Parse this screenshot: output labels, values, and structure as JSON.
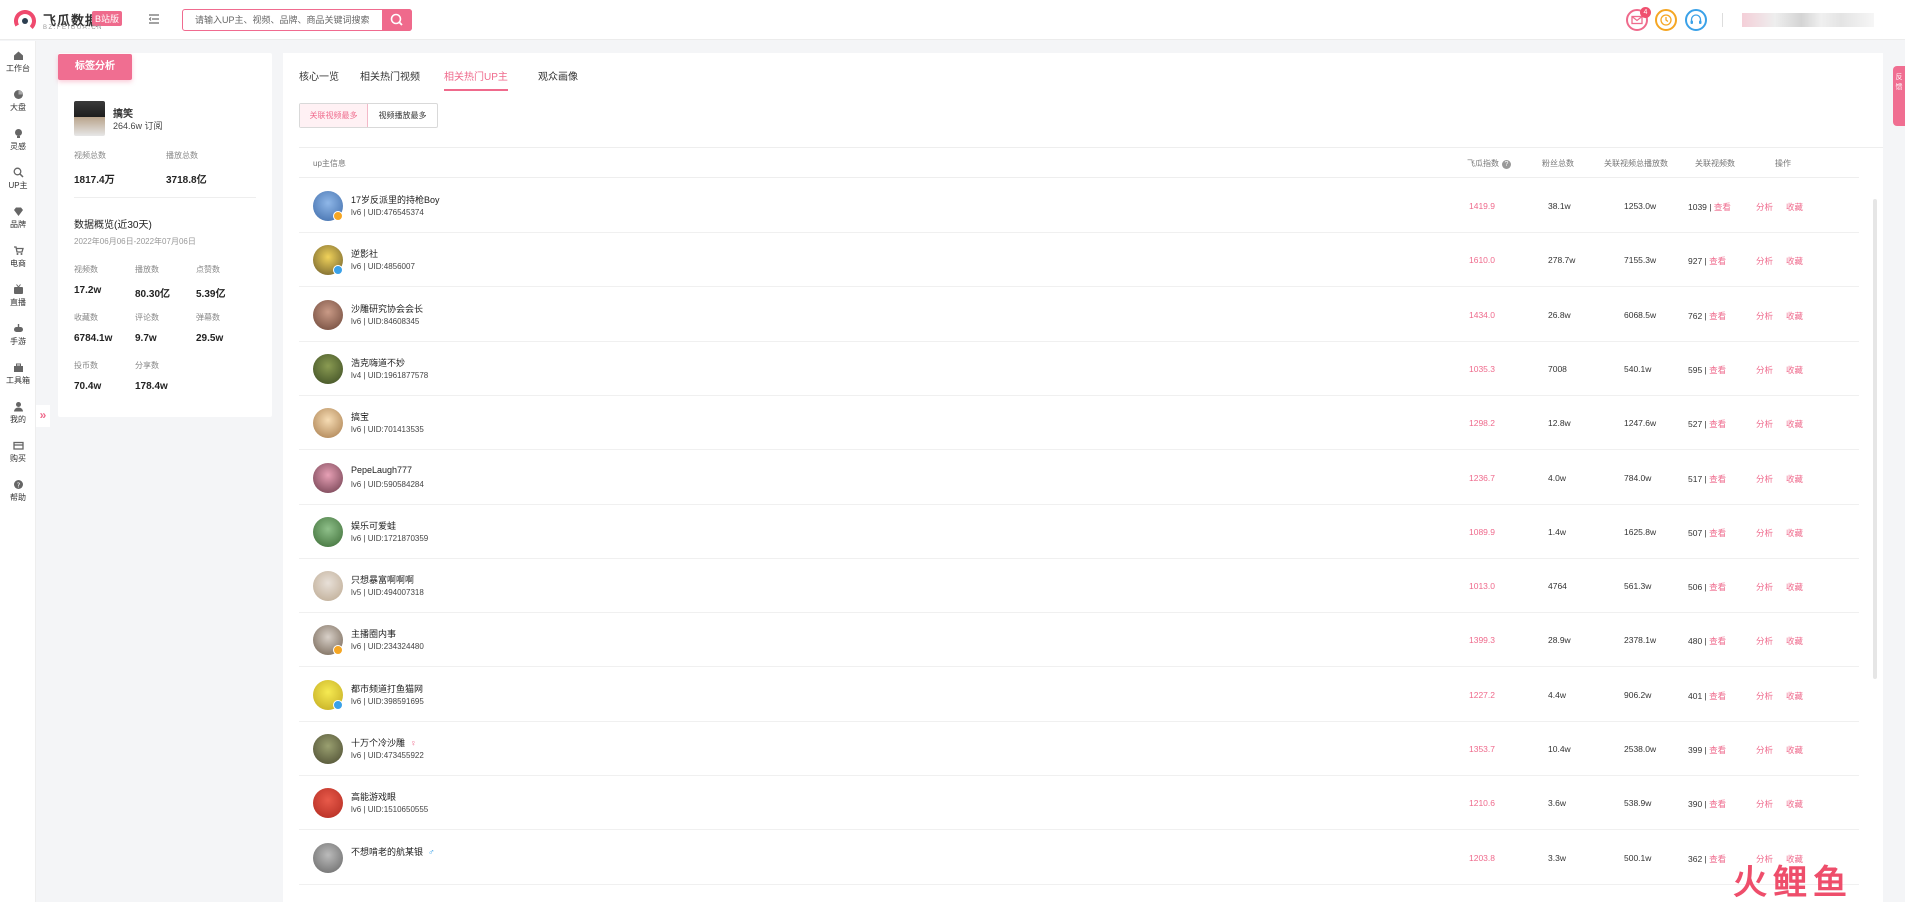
{
  "header": {
    "logo_name": "飞瓜数据",
    "logo_badge": "B站版",
    "logo_sub": "BZ.FEIGUA.CN",
    "search_placeholder": "请输入UP主、视频、品牌、商品关键词搜索",
    "notification_count": "4",
    "colors": {
      "accent": "#ef6a8c",
      "clock": "#f5a623",
      "support": "#3aa1e8"
    }
  },
  "nav": {
    "items": [
      {
        "label": "工作台",
        "icon": "home-icon"
      },
      {
        "label": "大盘",
        "icon": "pie-icon"
      },
      {
        "label": "灵感",
        "icon": "bulb-icon"
      },
      {
        "label": "UP主",
        "icon": "search-user-icon"
      },
      {
        "label": "品牌",
        "icon": "diamond-icon"
      },
      {
        "label": "电商",
        "icon": "cart-icon"
      },
      {
        "label": "直播",
        "icon": "tv-icon"
      },
      {
        "label": "手游",
        "icon": "gamepad-icon"
      },
      {
        "label": "工具箱",
        "icon": "toolbox-icon"
      },
      {
        "label": "我的",
        "icon": "user-icon"
      },
      {
        "label": "购买",
        "icon": "card-icon"
      },
      {
        "label": "帮助",
        "icon": "help-icon"
      }
    ],
    "expand_glyph": "»"
  },
  "profile": {
    "tag_button": "标签分析",
    "name": "搞笑",
    "subscribers": "264.6w 订阅",
    "video_total_label": "视频总数",
    "video_total": "1817.4万",
    "play_total_label": "播放总数",
    "play_total": "3718.8亿",
    "overview_title": "数据概览(近30天)",
    "overview_range": "2022年06月06日-2022年07月06日",
    "stats": [
      {
        "label": "视频数",
        "value": "17.2w"
      },
      {
        "label": "播放数",
        "value": "80.30亿"
      },
      {
        "label": "点赞数",
        "value": "5.39亿"
      },
      {
        "label": "收藏数",
        "value": "6784.1w"
      },
      {
        "label": "评论数",
        "value": "9.7w"
      },
      {
        "label": "弹幕数",
        "value": "29.5w"
      },
      {
        "label": "投币数",
        "value": "70.4w"
      },
      {
        "label": "分享数",
        "value": "178.4w"
      }
    ]
  },
  "tabs": [
    "核心一览",
    "相关热门视频",
    "相关热门UP主",
    "观众画像"
  ],
  "active_tab": 2,
  "subtabs": [
    "关联视频最多",
    "视频播放最多"
  ],
  "table": {
    "headers": {
      "info": "up主信息",
      "score": "飞瓜指数",
      "score_help": "?",
      "fans": "粉丝总数",
      "plays": "关联视频总播放数",
      "videos": "关联视频数",
      "action": "操作"
    },
    "view_label": "查看",
    "analyze_label": "分析",
    "fav_label": "收藏",
    "rows": [
      {
        "name": "17岁反派里的持枪Boy",
        "gender": "",
        "uid": "lv6 | UID:476545374",
        "score": "1419.9",
        "fans": "38.1w",
        "plays": "1253.0w",
        "videos": "1039"
      },
      {
        "name": "逆影社",
        "gender": "",
        "uid": "lv6 | UID:4856007",
        "score": "1610.0",
        "fans": "278.7w",
        "plays": "7155.3w",
        "videos": "927"
      },
      {
        "name": "沙雕研究协会会长",
        "gender": "",
        "uid": "lv6 | UID:84608345",
        "score": "1434.0",
        "fans": "26.8w",
        "plays": "6068.5w",
        "videos": "762"
      },
      {
        "name": "浩克嗨道不妙",
        "gender": "",
        "uid": "lv4 | UID:1961877578",
        "score": "1035.3",
        "fans": "7008",
        "plays": "540.1w",
        "videos": "595"
      },
      {
        "name": "搞宝",
        "gender": "",
        "uid": "lv6 | UID:701413535",
        "score": "1298.2",
        "fans": "12.8w",
        "plays": "1247.6w",
        "videos": "527"
      },
      {
        "name": "PepeLaugh777",
        "gender": "",
        "uid": "lv6 | UID:590584284",
        "score": "1236.7",
        "fans": "4.0w",
        "plays": "784.0w",
        "videos": "517"
      },
      {
        "name": "娱乐可爱蛙",
        "gender": "",
        "uid": "lv6 | UID:1721870359",
        "score": "1089.9",
        "fans": "1.4w",
        "plays": "1625.8w",
        "videos": "507"
      },
      {
        "name": "只想暴富啊啊啊",
        "gender": "",
        "uid": "lv5 | UID:494007318",
        "score": "1013.0",
        "fans": "4764",
        "plays": "561.3w",
        "videos": "506"
      },
      {
        "name": "主播圈内事",
        "gender": "",
        "uid": "lv6 | UID:234324480",
        "score": "1399.3",
        "fans": "28.9w",
        "plays": "2378.1w",
        "videos": "480"
      },
      {
        "name": "都市频道打鱼猫网",
        "gender": "",
        "uid": "lv6 | UID:398591695",
        "score": "1227.2",
        "fans": "4.4w",
        "plays": "906.2w",
        "videos": "401"
      },
      {
        "name": "十万个冷沙雕",
        "gender": "♀",
        "uid": "lv6 | UID:473455922",
        "score": "1353.7",
        "fans": "10.4w",
        "plays": "2538.0w",
        "videos": "399"
      },
      {
        "name": "高能游戏眼",
        "gender": "",
        "uid": "lv6 | UID:1510650555",
        "score": "1210.6",
        "fans": "3.6w",
        "plays": "538.9w",
        "videos": "390"
      },
      {
        "name": "不想啃老的航某银",
        "gender": "♂",
        "uid": "",
        "score": "1203.8",
        "fans": "3.3w",
        "plays": "500.1w",
        "videos": "362"
      }
    ]
  },
  "right_float": "反馈",
  "watermark": "火鲤鱼"
}
